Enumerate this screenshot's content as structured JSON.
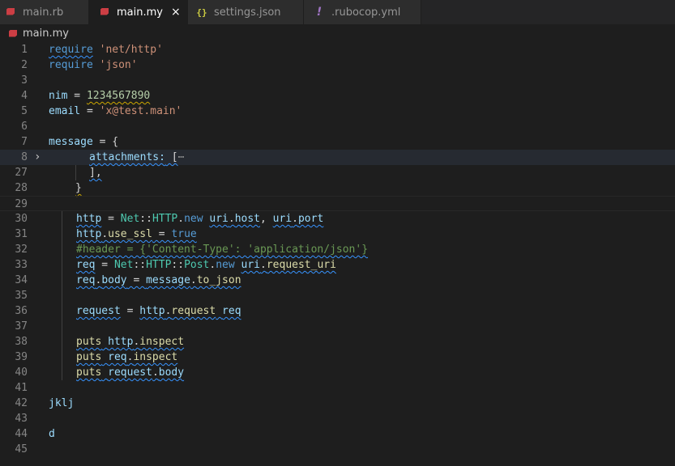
{
  "tabs": [
    {
      "label": "main.rb",
      "icon": "ruby-icon",
      "active": false
    },
    {
      "label": "main.my",
      "icon": "ruby-icon",
      "active": true,
      "close": "×"
    },
    {
      "label": "settings.json",
      "icon": "json-braces-icon",
      "icon_text": "{}",
      "active": false
    },
    {
      "label": ".rubocop.yml",
      "icon": "yaml-exclamation-icon",
      "icon_text": "!",
      "active": false
    }
  ],
  "breadcrumb": {
    "label": "main.my"
  },
  "fold_glyph": "›",
  "folded_ellipsis": "⋯",
  "code": {
    "l1": {
      "n": "1",
      "a": "require",
      "b": " ",
      "c": "'net/http'"
    },
    "l2": {
      "n": "2",
      "a": "require",
      "b": " ",
      "c": "'json'"
    },
    "l3": {
      "n": "3"
    },
    "l4": {
      "n": "4",
      "a": "nim",
      "b": " = ",
      "c": "1234567890"
    },
    "l5": {
      "n": "5",
      "a": "email",
      "b": " = ",
      "c": "'x@test.main'"
    },
    "l6": {
      "n": "6"
    },
    "l7": {
      "n": "7",
      "a": "message",
      "b": " = {"
    },
    "l8": {
      "n": "8",
      "a": "attachments:",
      "b": " [",
      "c": "⋯"
    },
    "l27": {
      "n": "27",
      "a": "],"
    },
    "l28": {
      "n": "28",
      "a": "}"
    },
    "l29": {
      "n": "29"
    },
    "l30": {
      "n": "30",
      "a": "http",
      "b": " = ",
      "c": "Net",
      "d": "::",
      "e": "HTTP",
      "f": ".",
      "g": "new",
      "h": " ",
      "i": "uri",
      "j": ".",
      "k": "host",
      "l": ", ",
      "m": "uri",
      "o": ".",
      "p": "port"
    },
    "l31": {
      "n": "31",
      "a": "http",
      "b": ".",
      "c": "use_ssl",
      "d": " = ",
      "e": "true"
    },
    "l32": {
      "n": "32",
      "a": "#header = {'Content-Type': 'application/json'}"
    },
    "l33": {
      "n": "33",
      "a": "req",
      "b": " = ",
      "c": "Net",
      "d": "::",
      "e": "HTTP",
      "f": "::",
      "g": "Post",
      "h": ".",
      "i": "new",
      "j": " ",
      "k": "uri",
      "l": ".",
      "m": "request_uri"
    },
    "l34": {
      "n": "34",
      "a": "req",
      "b": ".",
      "c": "body",
      "d": " = ",
      "e": "message",
      "f": ".",
      "g": "to_json"
    },
    "l35": {
      "n": "35"
    },
    "l36": {
      "n": "36",
      "a": "request",
      "b": " = ",
      "c": "http",
      "d": ".",
      "e": "request",
      "f": " ",
      "g": "req"
    },
    "l37": {
      "n": "37"
    },
    "l38": {
      "n": "38",
      "a": "puts",
      "b": " ",
      "c": "http",
      "d": ".",
      "e": "inspect"
    },
    "l39": {
      "n": "39",
      "a": "puts",
      "b": " ",
      "c": "req",
      "d": ".",
      "e": "inspect"
    },
    "l40": {
      "n": "40",
      "a": "puts",
      "b": " ",
      "c": "request",
      "d": ".",
      "e": "body"
    },
    "l41": {
      "n": "41"
    },
    "l42": {
      "n": "42",
      "a": "jklj"
    },
    "l43": {
      "n": "43"
    },
    "l44": {
      "n": "44",
      "a": "d"
    },
    "l45": {
      "n": "45"
    }
  }
}
